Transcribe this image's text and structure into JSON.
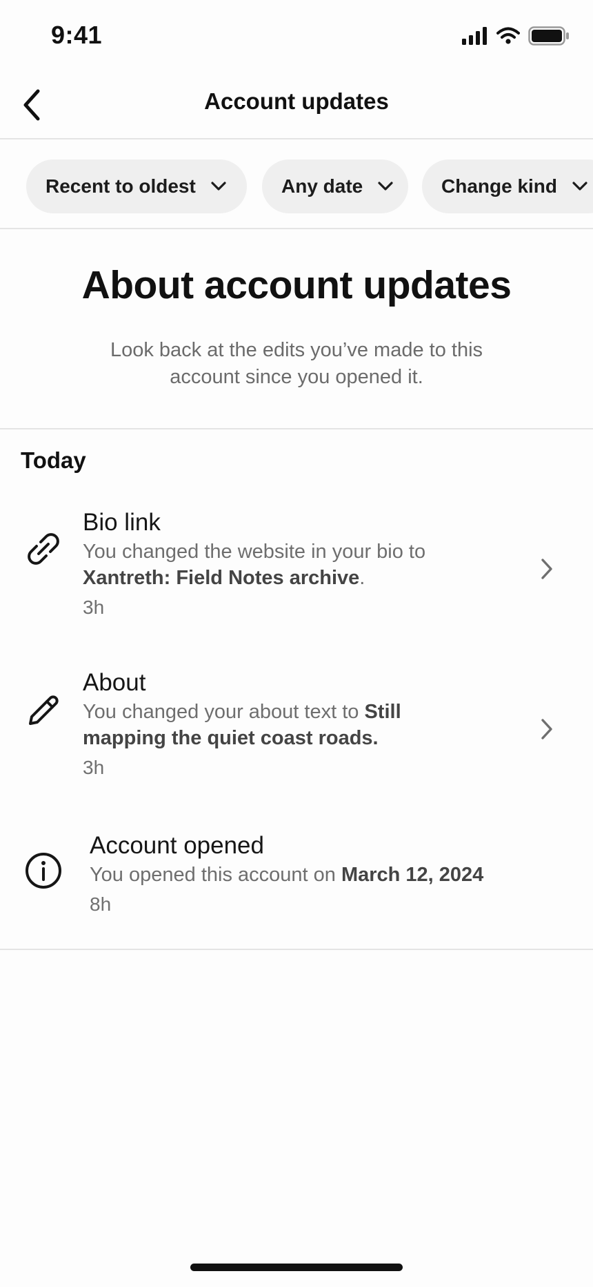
{
  "status_bar": {
    "time": "9:41"
  },
  "nav": {
    "title": "Account updates"
  },
  "filters": [
    {
      "label": "Recent to oldest"
    },
    {
      "label": "Any date"
    },
    {
      "label": "Change kind"
    }
  ],
  "about": {
    "title": "About account updates",
    "description": "Look back at the edits you’ve made to this account since you opened it."
  },
  "sections": {
    "today": "Today"
  },
  "entries": [
    {
      "icon": "link-icon",
      "title": "Bio link",
      "desc_prefix": "You changed the website in your bio to ",
      "desc_bold": "Xantreth: Field Notes archive",
      "desc_suffix": ".",
      "time": "3h"
    },
    {
      "icon": "pencil-icon",
      "title": "About",
      "desc_prefix": "You changed your about text to ",
      "desc_bold": "Still mapping the quiet coast roads.",
      "desc_suffix": "",
      "time": "3h"
    },
    {
      "icon": "info-icon",
      "title": "Account opened",
      "desc_prefix": "You opened this account on ",
      "desc_bold": "March 12, 2024",
      "desc_suffix": "",
      "time": "8h"
    }
  ]
}
